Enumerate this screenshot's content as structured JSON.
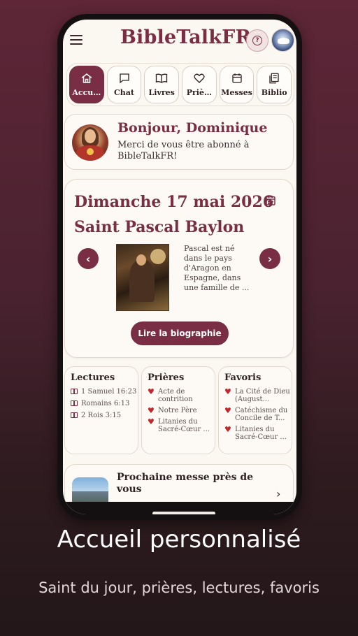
{
  "app": {
    "title": "BibleTalkFR"
  },
  "tabs": [
    {
      "label": "Accu…",
      "icon": "home-icon",
      "active": true
    },
    {
      "label": "Chat",
      "icon": "chat-icon",
      "active": false
    },
    {
      "label": "Livres",
      "icon": "book-open-icon",
      "active": false
    },
    {
      "label": "Priè…",
      "icon": "heart-icon",
      "active": false
    },
    {
      "label": "Messes",
      "icon": "calendar-icon",
      "active": false
    },
    {
      "label": "Biblio",
      "icon": "library-icon",
      "active": false
    }
  ],
  "welcome": {
    "greeting": "Bonjour, Dominique",
    "message": "Merci de vous être abonné à BibleTalkFR!"
  },
  "saint": {
    "date": "Dimanche 17 mai 2026",
    "name": "Saint Pascal Baylon",
    "bio": "Pascal est né dans le pays d'Aragon en Espagne, dans une famille de ...",
    "button": "Lire la biographie"
  },
  "readings": {
    "title": "Lectures",
    "items": [
      "1 Samuel 16:23",
      "Romains 6:13",
      "2 Rois 3:15"
    ]
  },
  "prayers": {
    "title": "Prières",
    "items": [
      "Acte de contrition",
      "Notre Père",
      "Litanies du Sacré-Cœur ..."
    ]
  },
  "favorites": {
    "title": "Favoris",
    "items": [
      "La Cité de Dieu (August...",
      "Catéchisme du Concile de T...",
      "Litanies du Sacré-Cœur ..."
    ]
  },
  "mass": {
    "title": "Prochaine messe près de vous"
  },
  "caption": {
    "title": "Accueil personnalisé",
    "subtitle": "Saint du jour, prières, lectures, favoris"
  },
  "colors": {
    "accent": "#7a2e45",
    "background": "#fbf7f1",
    "heart": "#c0282e"
  }
}
